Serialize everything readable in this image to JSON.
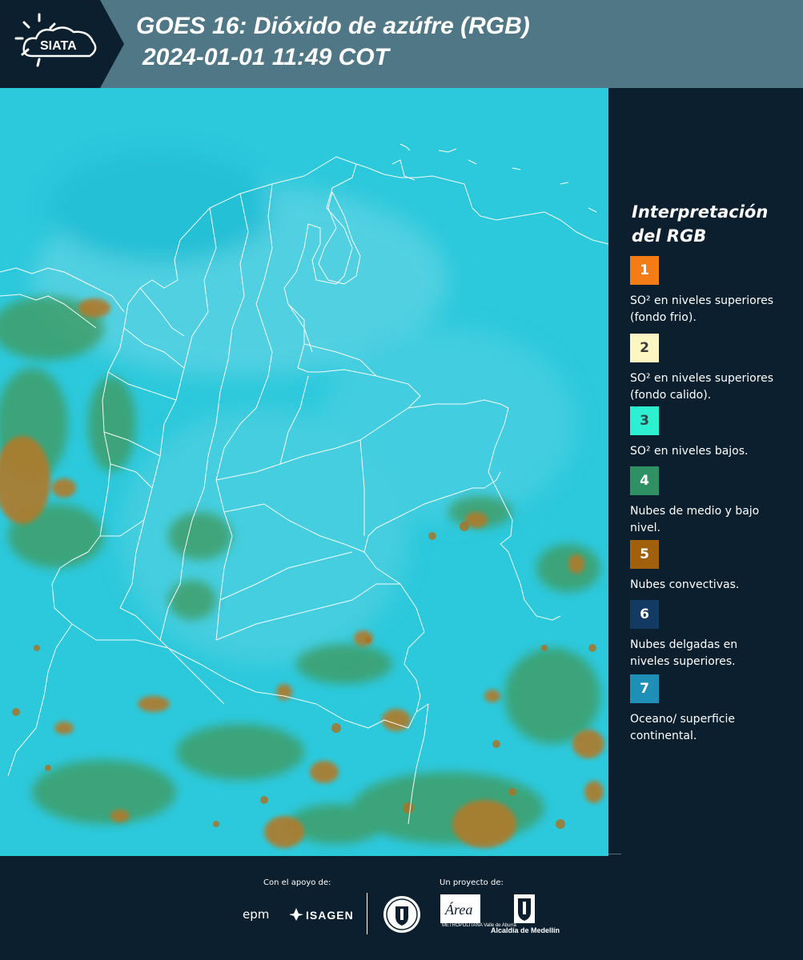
{
  "header": {
    "logo_text": "SIATA",
    "title_line1": "GOES 16: Dióxido de azúfre (RGB)",
    "title_line2": "2024-01-01 11:49 COT"
  },
  "legend": {
    "title_line1": "Interpretación",
    "title_line2": "del RGB",
    "items": [
      {
        "number": "1",
        "color": "#f47c16",
        "text_color": "#ffffff",
        "description": "SO² en niveles superiores (fondo frio)."
      },
      {
        "number": "2",
        "color": "#fdf6c3",
        "text_color": "#3a3a3a",
        "description": "SO² en niveles superiores (fondo calido)."
      },
      {
        "number": "3",
        "color": "#2cf0cf",
        "text_color": "#2b4a4e",
        "description": "SO² en niveles bajos."
      },
      {
        "number": "4",
        "color": "#2f9063",
        "text_color": "#ffffff",
        "description": "Nubes de medio y bajo nivel."
      },
      {
        "number": "5",
        "color": "#a0600c",
        "text_color": "#ffffff",
        "description": "Nubes convectivas."
      },
      {
        "number": "6",
        "color": "#123a63",
        "text_color": "#ffffff",
        "description": "Nubes delgadas en niveles superiores."
      },
      {
        "number": "7",
        "color": "#1e8fb6",
        "text_color": "#ffffff",
        "description": "Oceano/ superficie continental."
      }
    ]
  },
  "footer": {
    "support_label": "Con el apoyo de:",
    "project_label": "Un proyecto de:",
    "epm": "epm",
    "isagen": "ISAGEN",
    "area_logo_text": "Área",
    "area_sub": "METROPOLITANA Valle de Aburrá",
    "alcaldia": "Alcaldía de Medellín"
  },
  "colors": {
    "header_bg": "#4f7786",
    "logo_bg": "#0c1f2e",
    "page_bg": "#0c1f2e",
    "map_ocean": "#2cc8dc",
    "cloud_low": "#3f9b62",
    "cloud_convective": "#b07a2a",
    "border_lines": "#ffffff"
  }
}
